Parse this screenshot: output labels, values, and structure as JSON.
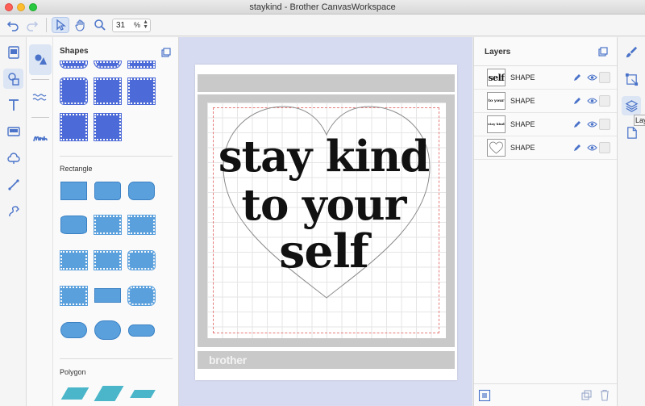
{
  "window": {
    "title": "staykind - Brother CanvasWorkspace"
  },
  "toolbar": {
    "zoom_value": "31",
    "zoom_unit": "%"
  },
  "shapes_panel": {
    "title": "Shapes",
    "sections": [
      "Rectangle",
      "Polygon"
    ]
  },
  "canvas": {
    "brand_text": "brother",
    "artwork_lines": [
      "stay kind",
      "to your",
      "self"
    ]
  },
  "layers_panel": {
    "title": "Layers",
    "items": [
      {
        "thumb": "self",
        "label": "SHAPE"
      },
      {
        "thumb": "to your",
        "label": "SHAPE"
      },
      {
        "thumb": "stay kind",
        "label": "SHAPE"
      },
      {
        "thumb": "",
        "label": "SHAPE"
      }
    ]
  },
  "right_rail": {
    "tooltip": "Layers"
  },
  "colors": {
    "accent": "#4d6bd8",
    "shape_blue": "#5aa0dd",
    "polygon_teal": "#4bb6c9",
    "canvas_bg": "#d6dbf1",
    "mat_gray": "#c9c9c9"
  }
}
